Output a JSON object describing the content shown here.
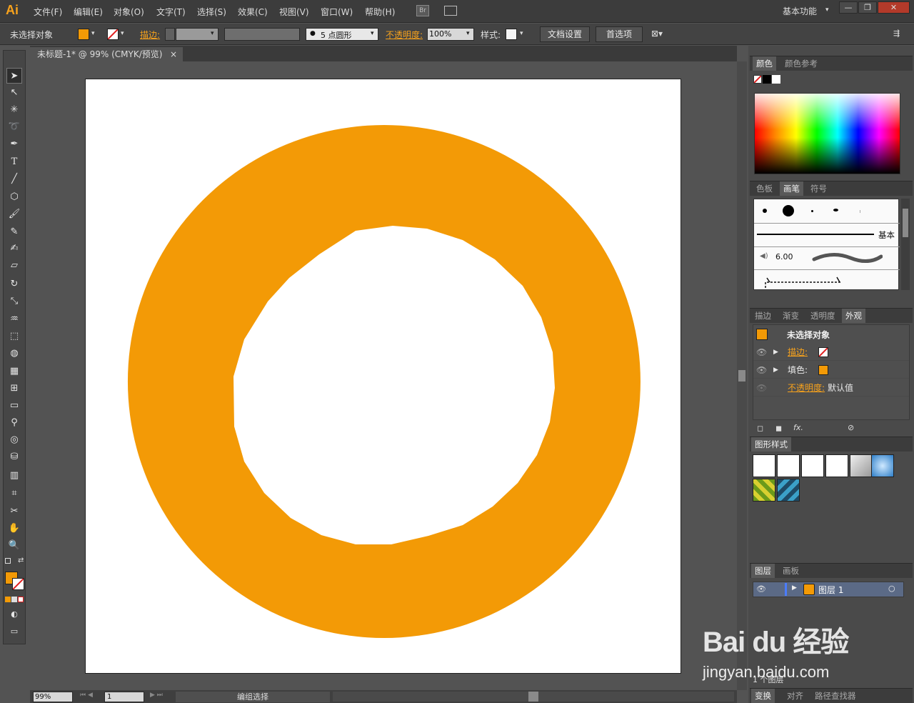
{
  "app": {
    "logo": "Ai",
    "workspace": "基本功能"
  },
  "menu": [
    "文件(F)",
    "编辑(E)",
    "对象(O)",
    "文字(T)",
    "选择(S)",
    "效果(C)",
    "视图(V)",
    "窗口(W)",
    "帮助(H)"
  ],
  "control": {
    "selection": "未选择对象",
    "stroke_label": "描边:",
    "brush_value": "5 点圆形",
    "opacity_label": "不透明度:",
    "opacity_value": "100%",
    "style_label": "样式:",
    "doc_setup": "文档设置",
    "prefs": "首选项"
  },
  "document": {
    "tab_title": "未标题-1* @ 99% (CMYK/预览)",
    "close": "×"
  },
  "artwork": {
    "fill_color": "#f39a06"
  },
  "status": {
    "zoom": "99%",
    "page": "1",
    "mode": "编组选择"
  },
  "panels": {
    "color": {
      "tabs": [
        "颜色",
        "颜色参考"
      ]
    },
    "swatches": {
      "tabs": [
        "色板",
        "画笔",
        "符号"
      ],
      "basic": "基本",
      "brush_size": "6.00"
    },
    "appearance": {
      "tabs": [
        "描边",
        "渐变",
        "透明度",
        "外观"
      ],
      "title": "未选择对象",
      "stroke": "描边:",
      "fill": "填色:",
      "opacity": "不透明度:",
      "opacity_value": "默认值",
      "fx": "fx."
    },
    "graphic_styles": {
      "tabs": [
        "图形样式"
      ]
    },
    "layers": {
      "tabs": [
        "图层",
        "画板"
      ],
      "layer_name": "图层 1",
      "count": "1 个图层"
    },
    "bottom": {
      "tabs": [
        "变换",
        "对齐",
        "路径查找器"
      ]
    }
  },
  "watermark": {
    "logo_text": "Bai du 经验",
    "url": "jingyan.baidu.com"
  }
}
